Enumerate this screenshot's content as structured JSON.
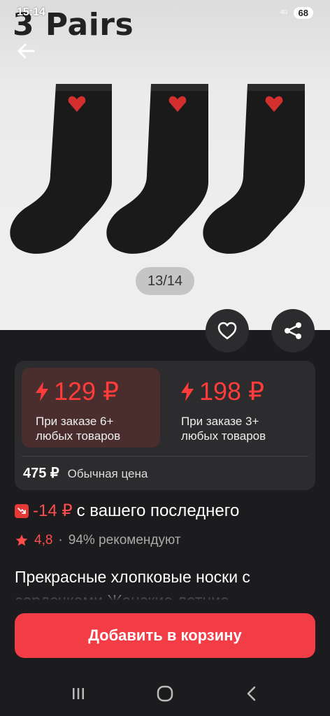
{
  "status": {
    "time": "15:14",
    "network": "4G",
    "battery": "68"
  },
  "hero": {
    "title": "3 Pairs",
    "counter": "13/14"
  },
  "icons": {
    "back": "arrow-left-icon",
    "favorite": "heart-outline-icon",
    "share": "share-icon",
    "lightning": "lightning-icon",
    "discount": "price-drop-icon",
    "star": "star-icon"
  },
  "pricing": {
    "tiers": [
      {
        "price": "129 ₽",
        "note": "При заказе 6+ любых товаров"
      },
      {
        "price": "198 ₽",
        "note": "При заказе 3+ любых товаров"
      }
    ],
    "regular_price": "475 ₽",
    "regular_label": "Обычная цена"
  },
  "discount": {
    "amount": "-14 ₽",
    "text": "с вашего последнего"
  },
  "rating": {
    "score": "4,8",
    "separator": "·",
    "recommend": "94% рекомендуют"
  },
  "description": "Прекрасные хлопковые носки с сердечками Женские летние",
  "actions": {
    "add_to_cart": "Добавить в корзину"
  },
  "colors": {
    "accent": "#f23c46",
    "price_red": "#ff3b3b",
    "background": "#1c1c1e"
  }
}
